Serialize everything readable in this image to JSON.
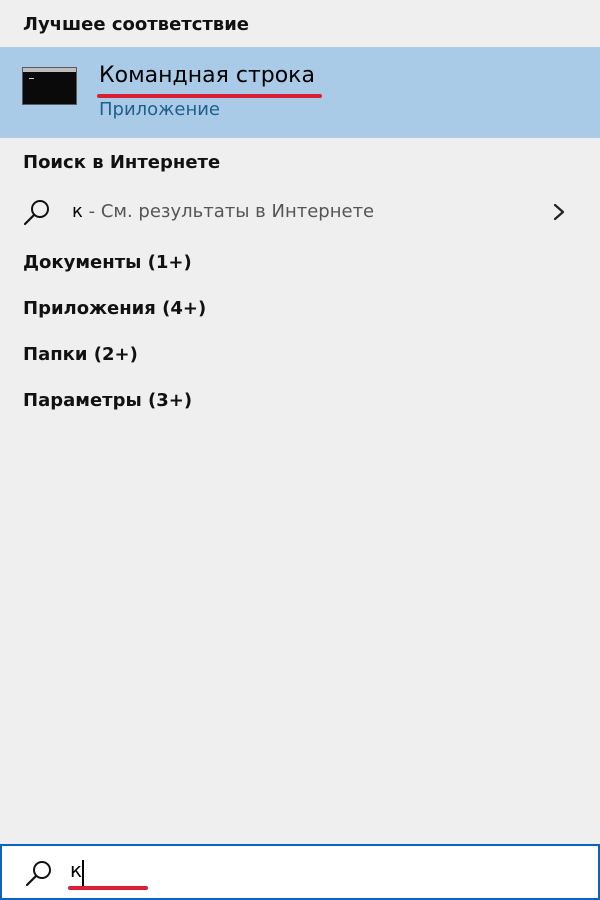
{
  "best_match": {
    "header": "Лучшее соответствие",
    "title": "Командная строка",
    "subtitle": "Приложение",
    "icon": "command-prompt-icon"
  },
  "web": {
    "header": "Поиск в Интернете",
    "query": "к",
    "suffix": " - См. результаты в Интернете",
    "icon": "search-icon",
    "chevron_icon": "chevron-right-icon"
  },
  "categories": [
    "Документы (1+)",
    "Приложения (4+)",
    "Папки (2+)",
    "Параметры (3+)"
  ],
  "search_box": {
    "value": "к",
    "icon": "search-icon"
  },
  "colors": {
    "selection": "#a9cbe8",
    "annotation_red": "#d81f35",
    "focus_border": "#0a63c2",
    "subtitle": "#1f5f8b"
  }
}
